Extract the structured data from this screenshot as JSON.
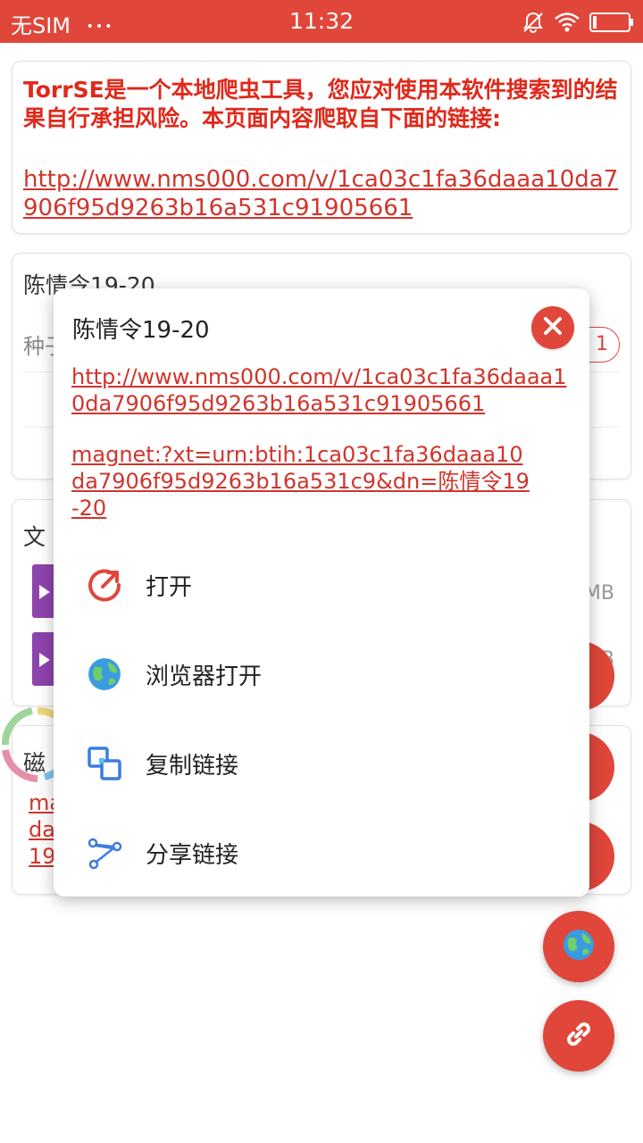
{
  "status_bar": {
    "carrier": "无SIM",
    "dots": "•••",
    "time": "11:32"
  },
  "notice": {
    "text": "TorrSE是一个本地爬虫工具，您应对使用本软件搜索到的结果自行承担风险。本页面内容爬取自下面的链接:",
    "url": "http://www.nms000.com/v/1ca03c1fa36daaa10da7906f95d9263b16a531c91905661"
  },
  "torrent_card": {
    "title": "陈情令19-20",
    "seed_label_partial": "种子",
    "badge_partial": "1"
  },
  "files_card": {
    "title_partial": "文",
    "size_partial_1": "MB",
    "size_partial_2": "B"
  },
  "magnet_card": {
    "title_partial": "磁",
    "link_line1_partial": "ma",
    "link_line2_partial": "da",
    "link_line3_partial": "19"
  },
  "dialog": {
    "title": "陈情令19-20",
    "url": "http://www.nms000.com/v/1ca03c1fa36daaa10da7906f95d9263b16a531c91905661",
    "magnet": "magnet:?xt=urn:btih:1ca03c1fa36daaa10da7906f95d9263b16a531c9&dn=陈情令19-20",
    "items": [
      {
        "label": "打开",
        "icon": "open-icon"
      },
      {
        "label": "浏览器打开",
        "icon": "globe-icon"
      },
      {
        "label": "复制链接",
        "icon": "copy-icon"
      },
      {
        "label": "分享链接",
        "icon": "share-icon"
      }
    ]
  },
  "colors": {
    "accent": "#e0463a",
    "link": "#d0352c",
    "notice_text": "#e0291b"
  }
}
